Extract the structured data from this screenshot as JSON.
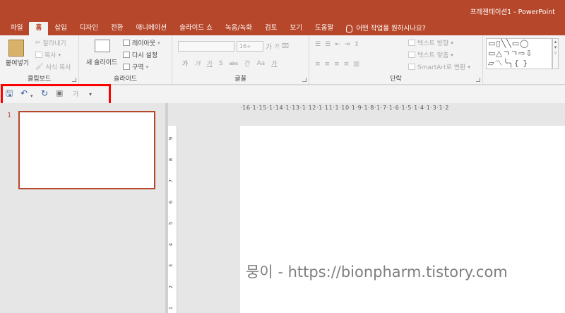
{
  "window": {
    "title": "프레젠테이션1  -  PowerPoint"
  },
  "tabs": [
    {
      "label": "파일"
    },
    {
      "label": "홈",
      "active": true
    },
    {
      "label": "삽입"
    },
    {
      "label": "디자인"
    },
    {
      "label": "전환"
    },
    {
      "label": "애니메이션"
    },
    {
      "label": "슬라이드 쇼"
    },
    {
      "label": "녹음/녹화"
    },
    {
      "label": "검토"
    },
    {
      "label": "보기"
    },
    {
      "label": "도움말"
    }
  ],
  "tell_me": "어떤 작업을 원하시나요?",
  "ribbon": {
    "clipboard": {
      "paste": "붙여넣기",
      "cut": "잘라내기",
      "copy": "복사",
      "format_painter": "서식 복사",
      "label": "클립보드"
    },
    "slides": {
      "new_slide": "새 슬라이드",
      "layout": "레이아웃",
      "reset": "다시 설정",
      "section": "구역",
      "label": "슬라이드"
    },
    "font": {
      "size": "16+",
      "grow": "가",
      "shrink": "가",
      "bold": "가",
      "italic": "가",
      "underline": "가",
      "shadow": "S",
      "strike": "abc",
      "spacing": "간",
      "case": "Aa",
      "color": "가",
      "label": "글꼴"
    },
    "paragraph": {
      "text_direction": "텍스트 방향",
      "align_text": "텍스트 맞춤",
      "smartart": "SmartArt로 변환",
      "label": "단락"
    },
    "drawing": {
      "shapes": "▭▯╲╲▭◯\n▭△ㄱㄱ⇨⇩\n▱〽╰╮{ }"
    }
  },
  "qat": {
    "font_placeholder": "가"
  },
  "thumbnails": {
    "slide_number": "1"
  },
  "ruler": {
    "h": "·16·1·15·1·14·1·13·1·12·1·11·1·10·1·9·1·8·1·7·1·6·1·5·1·4·1·3·1·2",
    "v": [
      "9",
      "8",
      "7",
      "6",
      "5",
      "4",
      "3",
      "2",
      "1"
    ]
  },
  "watermark": "뭉이 - https://bionpharm.tistory.com",
  "colors": {
    "accent": "#b7472a",
    "highlight": "#ff0000"
  }
}
